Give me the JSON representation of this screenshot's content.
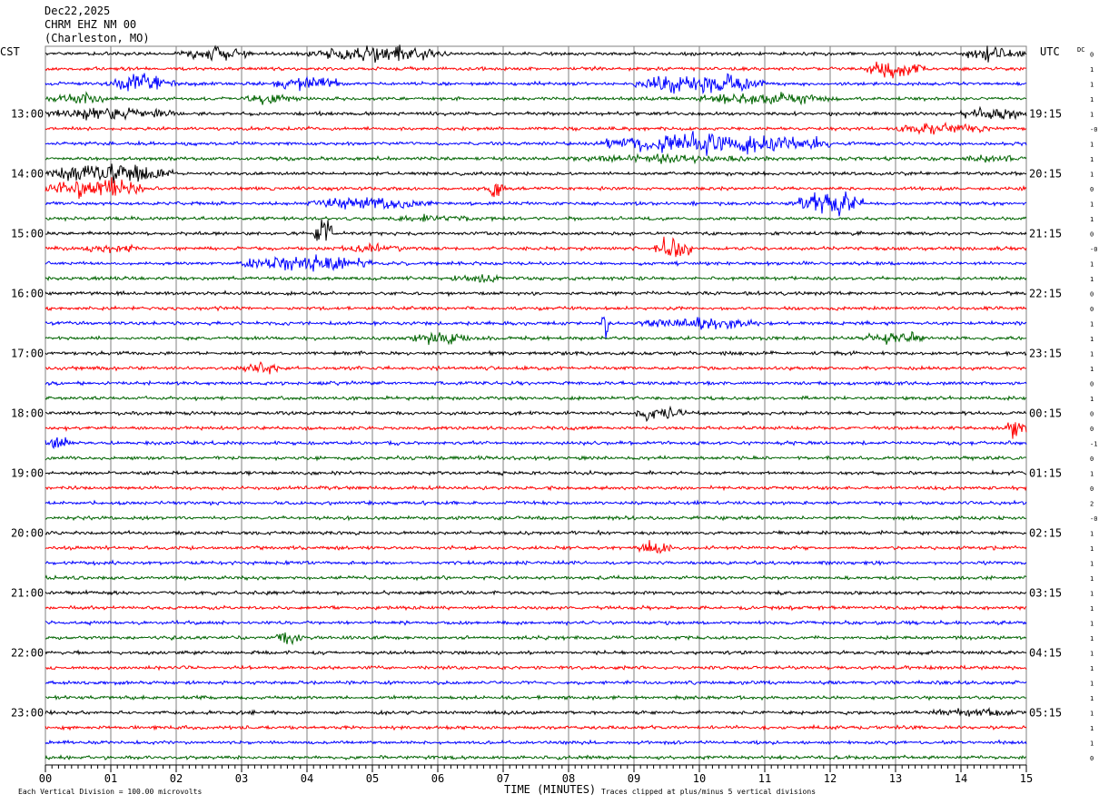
{
  "header": {
    "date": "Dec22,2025",
    "station": "CHRM EHZ NM 00",
    "location": "(Charleston, MO)"
  },
  "labels": {
    "left_tz": "CST",
    "right_tz": "UTC",
    "dc": "DC",
    "xlabel": "TIME (MINUTES)",
    "scale_note": "Each Vertical Division =  100.00 microvolts",
    "clip_note": "Traces clipped at plus/minus 5 vertical divisions"
  },
  "chart_data": {
    "type": "line",
    "x_ticks": [
      "00",
      "01",
      "02",
      "03",
      "04",
      "05",
      "06",
      "07",
      "08",
      "09",
      "10",
      "11",
      "12",
      "13",
      "14",
      "15"
    ],
    "xlim": [
      0,
      15
    ],
    "grid": true,
    "trace_colors": [
      "#000000",
      "#ff0000",
      "#0000ff",
      "#006400"
    ],
    "left_hour_labels": [
      "13:00",
      "14:00",
      "15:00",
      "16:00",
      "17:00",
      "18:00",
      "19:00",
      "20:00",
      "21:00",
      "22:00",
      "23:00"
    ],
    "right_hour_labels": [
      "19:15",
      "20:15",
      "21:15",
      "22:15",
      "23:15",
      "00:15",
      "01:15",
      "02:15",
      "03:15",
      "04:15",
      "05:15"
    ],
    "dc_offsets": [
      "0",
      "1",
      "1",
      "1",
      "1",
      "-0",
      "1",
      "1",
      "1",
      "0",
      "1",
      "1",
      "0",
      "-0",
      "1",
      "1",
      "0",
      "0",
      "1",
      "1",
      "1",
      "1",
      "0",
      "1",
      "0",
      "0",
      "-1",
      "0",
      "1",
      "0",
      "2",
      "-0",
      "1",
      "1",
      "1",
      "1",
      "1",
      "1",
      "1",
      "1",
      "1",
      "1",
      "1",
      "1",
      "1",
      "1",
      "1",
      "0"
    ],
    "trace_count": 48,
    "events": [
      {
        "trace": 0,
        "start_min": 2.0,
        "end_min": 3.2,
        "amp": 0.35
      },
      {
        "trace": 0,
        "start_min": 4.0,
        "end_min": 6.2,
        "amp": 0.45
      },
      {
        "trace": 0,
        "start_min": 14.0,
        "end_min": 15.0,
        "amp": 0.4
      },
      {
        "trace": 1,
        "start_min": 12.5,
        "end_min": 13.5,
        "amp": 0.45
      },
      {
        "trace": 2,
        "start_min": 1.0,
        "end_min": 2.0,
        "amp": 0.5
      },
      {
        "trace": 2,
        "start_min": 3.5,
        "end_min": 4.5,
        "amp": 0.45
      },
      {
        "trace": 2,
        "start_min": 9.0,
        "end_min": 11.0,
        "amp": 0.55
      },
      {
        "trace": 3,
        "start_min": 0.0,
        "end_min": 1.0,
        "amp": 0.3
      },
      {
        "trace": 3,
        "start_min": 3.0,
        "end_min": 4.0,
        "amp": 0.3
      },
      {
        "trace": 3,
        "start_min": 10.0,
        "end_min": 12.0,
        "amp": 0.35
      },
      {
        "trace": 4,
        "start_min": 0.0,
        "end_min": 2.0,
        "amp": 0.35
      },
      {
        "trace": 4,
        "start_min": 14.0,
        "end_min": 15.0,
        "amp": 0.4
      },
      {
        "trace": 5,
        "start_min": 13.0,
        "end_min": 14.5,
        "amp": 0.35
      },
      {
        "trace": 6,
        "start_min": 8.5,
        "end_min": 12.0,
        "amp": 0.6
      },
      {
        "trace": 7,
        "start_min": 8.0,
        "end_min": 11.0,
        "amp": 0.25
      },
      {
        "trace": 7,
        "start_min": 14.0,
        "end_min": 15.0,
        "amp": 0.25
      },
      {
        "trace": 8,
        "start_min": 0.0,
        "end_min": 2.0,
        "amp": 0.5
      },
      {
        "trace": 9,
        "start_min": 0.0,
        "end_min": 1.5,
        "amp": 0.55
      },
      {
        "trace": 9,
        "start_min": 6.7,
        "end_min": 7.0,
        "amp": 0.5
      },
      {
        "trace": 10,
        "start_min": 4.0,
        "end_min": 6.0,
        "amp": 0.35
      },
      {
        "trace": 10,
        "start_min": 11.5,
        "end_min": 12.5,
        "amp": 0.8
      },
      {
        "trace": 11,
        "start_min": 5.0,
        "end_min": 7.0,
        "amp": 0.2
      },
      {
        "trace": 12,
        "start_min": 4.1,
        "end_min": 4.4,
        "amp": 0.9
      },
      {
        "trace": 13,
        "start_min": 0.5,
        "end_min": 1.5,
        "amp": 0.25
      },
      {
        "trace": 13,
        "start_min": 4.5,
        "end_min": 5.5,
        "amp": 0.25
      },
      {
        "trace": 13,
        "start_min": 9.3,
        "end_min": 9.9,
        "amp": 0.6
      },
      {
        "trace": 14,
        "start_min": 3.0,
        "end_min": 5.0,
        "amp": 0.45
      },
      {
        "trace": 15,
        "start_min": 6.2,
        "end_min": 7.0,
        "amp": 0.3
      },
      {
        "trace": 18,
        "start_min": 8.5,
        "end_min": 8.6,
        "amp": 0.9
      },
      {
        "trace": 18,
        "start_min": 9.0,
        "end_min": 11.0,
        "amp": 0.35
      },
      {
        "trace": 19,
        "start_min": 5.5,
        "end_min": 6.5,
        "amp": 0.35
      },
      {
        "trace": 19,
        "start_min": 12.5,
        "end_min": 13.5,
        "amp": 0.35
      },
      {
        "trace": 21,
        "start_min": 3.0,
        "end_min": 3.6,
        "amp": 0.35
      },
      {
        "trace": 24,
        "start_min": 9.0,
        "end_min": 9.8,
        "amp": 0.4
      },
      {
        "trace": 25,
        "start_min": 14.7,
        "end_min": 15.0,
        "amp": 0.6
      },
      {
        "trace": 26,
        "start_min": 0.0,
        "end_min": 0.4,
        "amp": 0.4
      },
      {
        "trace": 33,
        "start_min": 9.0,
        "end_min": 9.6,
        "amp": 0.35
      },
      {
        "trace": 39,
        "start_min": 3.5,
        "end_min": 4.0,
        "amp": 0.3
      },
      {
        "trace": 44,
        "start_min": 13.5,
        "end_min": 15.0,
        "amp": 0.25
      }
    ]
  }
}
